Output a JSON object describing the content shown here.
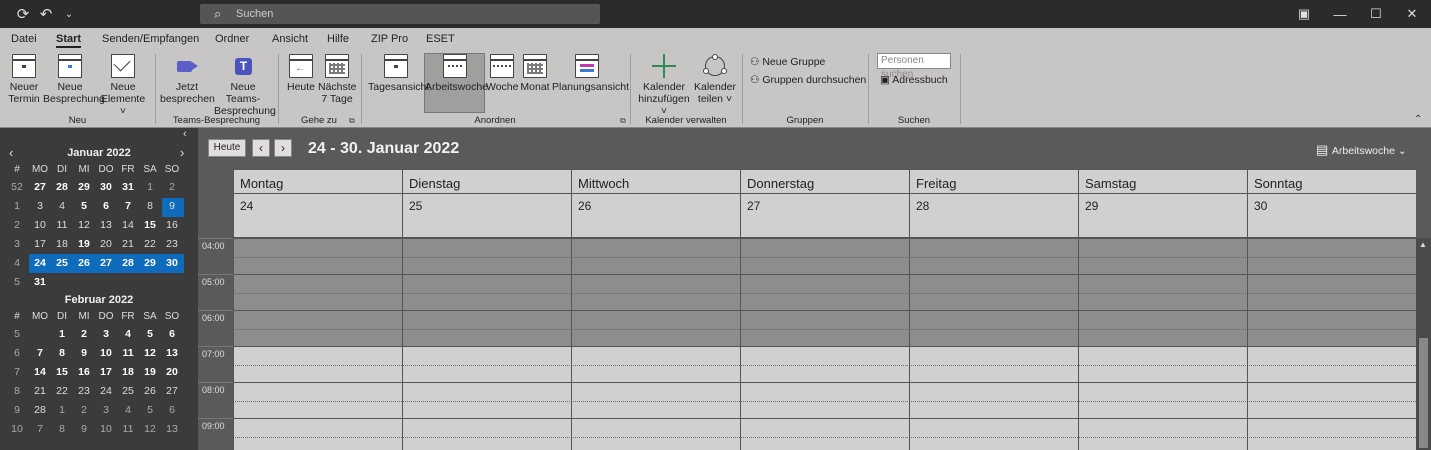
{
  "titlebar": {
    "search_placeholder": "Suchen"
  },
  "menu": {
    "tabs": [
      "Datei",
      "Start",
      "Senden/Empfangen",
      "Ordner",
      "Ansicht",
      "Hilfe",
      "ZIP Pro",
      "ESET"
    ]
  },
  "ribbon": {
    "neuer_termin": [
      "Neuer",
      "Termin"
    ],
    "neue_besprechung": [
      "Neue",
      "Besprechung"
    ],
    "neue_elemente": [
      "Neue",
      "Elemente ˅"
    ],
    "group_neu": "Neu",
    "jetzt_besprechen": [
      "Jetzt",
      "besprechen"
    ],
    "neue_teams": [
      "Neue Teams-",
      "Besprechung"
    ],
    "group_teams": "Teams-Besprechung",
    "heute": "Heute",
    "naechste": [
      "Nächste",
      "7 Tage"
    ],
    "group_gehe": "Gehe zu",
    "tagesansicht": "Tagesansicht",
    "arbeitswoche": "Arbeitswoche",
    "woche": "Woche",
    "monat": "Monat",
    "planungsansicht": "Planungsansicht",
    "group_anordnen": "Anordnen",
    "kalender_hinzu": [
      "Kalender",
      "hinzufügen ˅"
    ],
    "kalender_teilen": [
      "Kalender",
      "teilen ˅"
    ],
    "group_kalender": "Kalender verwalten",
    "neue_gruppe": "Neue Gruppe",
    "gruppen_durchsuchen": "Gruppen durchsuchen",
    "group_gruppen": "Gruppen",
    "personen_suchen": "Personen suchen",
    "adressbuch": "Adressbuch",
    "group_suchen": "Suchen"
  },
  "minical": {
    "headers": [
      "#",
      "MO",
      "DI",
      "MI",
      "DO",
      "FR",
      "SA",
      "SO"
    ],
    "jan": {
      "title": "Januar 2022",
      "rows": [
        [
          "52",
          "27",
          "28",
          "29",
          "30",
          "31",
          "1",
          "2"
        ],
        [
          "1",
          "3",
          "4",
          "5",
          "6",
          "7",
          "8",
          "9"
        ],
        [
          "2",
          "10",
          "11",
          "12",
          "13",
          "14",
          "15",
          "16"
        ],
        [
          "3",
          "17",
          "18",
          "19",
          "20",
          "21",
          "22",
          "23"
        ],
        [
          "4",
          "24",
          "25",
          "26",
          "27",
          "28",
          "29",
          "30"
        ],
        [
          "5",
          "31",
          "",
          "",
          "",
          "",
          "",
          ""
        ]
      ]
    },
    "feb": {
      "title": "Februar 2022",
      "rows": [
        [
          "5",
          "",
          "1",
          "2",
          "3",
          "4",
          "5",
          "6"
        ],
        [
          "6",
          "7",
          "8",
          "9",
          "10",
          "11",
          "12",
          "13"
        ],
        [
          "7",
          "14",
          "15",
          "16",
          "17",
          "18",
          "19",
          "20"
        ],
        [
          "8",
          "21",
          "22",
          "23",
          "24",
          "25",
          "26",
          "27"
        ],
        [
          "9",
          "28",
          "1",
          "2",
          "3",
          "4",
          "5",
          "6"
        ],
        [
          "10",
          "7",
          "8",
          "9",
          "10",
          "11",
          "12",
          "13"
        ]
      ]
    }
  },
  "main": {
    "heute": "Heute",
    "range_title": "24 - 30. Januar 2022",
    "view_selector": "Arbeitswoche",
    "days": [
      {
        "name": "Montag",
        "num": "24"
      },
      {
        "name": "Dienstag",
        "num": "25"
      },
      {
        "name": "Mittwoch",
        "num": "26"
      },
      {
        "name": "Donnerstag",
        "num": "27"
      },
      {
        "name": "Freitag",
        "num": "28"
      },
      {
        "name": "Samstag",
        "num": "29"
      },
      {
        "name": "Sonntag",
        "num": "30"
      }
    ],
    "hours": [
      "04:00",
      "05:00",
      "06:00",
      "07:00",
      "08:00",
      "09:00"
    ]
  },
  "colors": {
    "accent": "#0f6cbd",
    "ribbon_bg": "#c8c6c4"
  }
}
